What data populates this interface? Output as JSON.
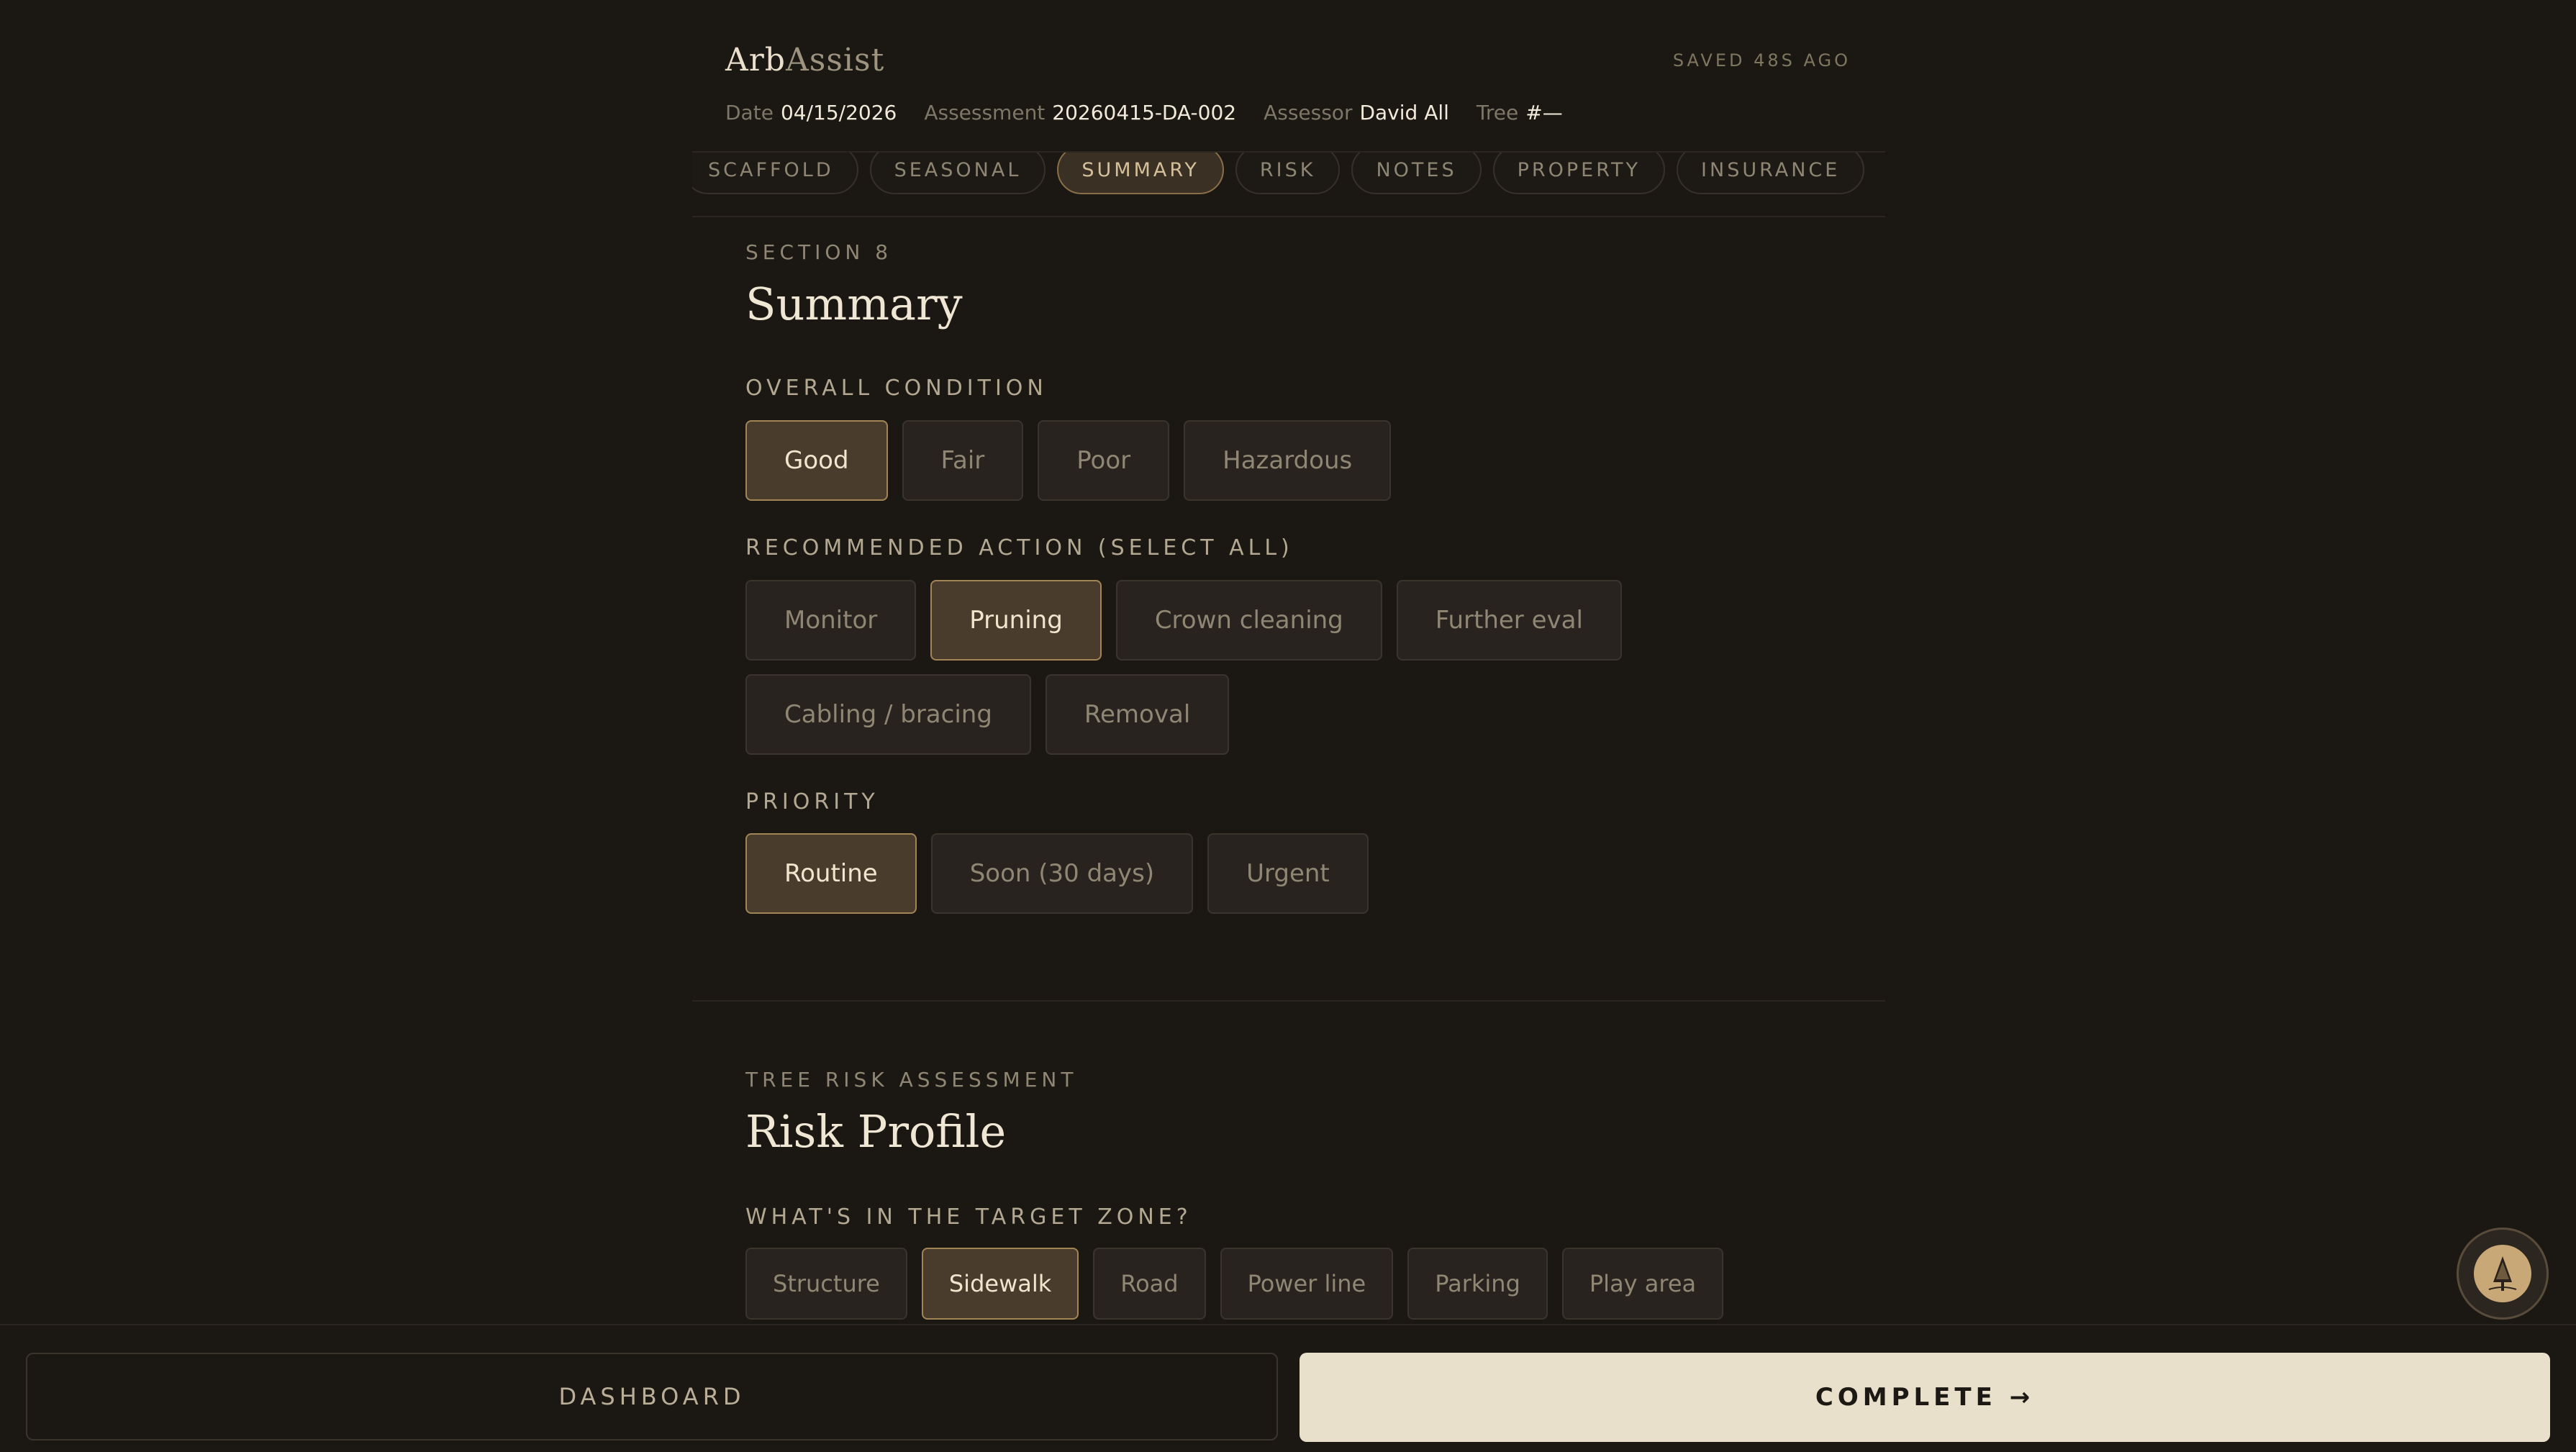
{
  "app": {
    "brand_part1": "Arb",
    "brand_part2": "Assist",
    "saved_status": "SAVED 48S AGO"
  },
  "meta": {
    "date_label": "Date",
    "date_value": "04/15/2026",
    "assessment_label": "Assessment",
    "assessment_value": "20260415-DA-002",
    "assessor_label": "Assessor",
    "assessor_value": "David All",
    "tree_label": "Tree",
    "tree_value": "#—"
  },
  "tabs": [
    "SCAFFOLD",
    "SEASONAL",
    "SUMMARY",
    "RISK",
    "NOTES",
    "PROPERTY",
    "INSURANCE"
  ],
  "tabs_active": "SUMMARY",
  "summary": {
    "eyebrow": "SECTION 8",
    "title": "Summary",
    "condition_label": "OVERALL CONDITION",
    "condition_options": [
      "Good",
      "Fair",
      "Poor",
      "Hazardous"
    ],
    "condition_selected": "Good",
    "action_label": "RECOMMENDED ACTION (SELECT ALL)",
    "action_options": [
      "Monitor",
      "Pruning",
      "Crown cleaning",
      "Further eval",
      "Cabling / bracing",
      "Removal"
    ],
    "action_selected": [
      "Pruning"
    ],
    "priority_label": "PRIORITY",
    "priority_options": [
      "Routine",
      "Soon (30 days)",
      "Urgent"
    ],
    "priority_selected": "Routine"
  },
  "risk": {
    "eyebrow": "TREE RISK ASSESSMENT",
    "title": "Risk Profile",
    "target_label": "WHAT'S IN THE TARGET ZONE?",
    "target_options": [
      "Structure",
      "Sidewalk",
      "Road",
      "Power line",
      "Parking",
      "Play area"
    ],
    "target_selected": [
      "Sidewalk"
    ]
  },
  "footer": {
    "dashboard_label": "DASHBOARD",
    "complete_label": "COMPLETE →"
  },
  "fab": {
    "icon": "tree-logo-icon"
  },
  "colors": {
    "background": "#1b1814",
    "accent": "#a28456",
    "selected_fill": "#4a3c2d",
    "complete_button": "#e9e0cb"
  }
}
